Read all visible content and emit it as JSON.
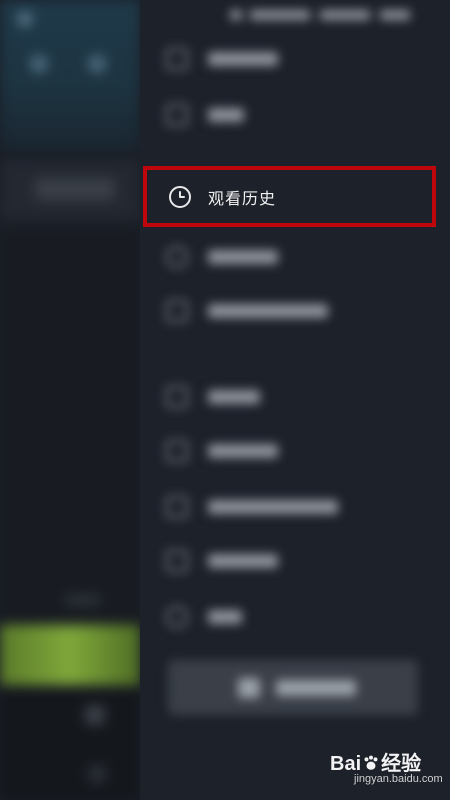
{
  "menu": {
    "highlighted_item": {
      "label": "观看历史",
      "icon": "clock-icon"
    }
  },
  "colors": {
    "highlight_border": "#c0060d",
    "drawer_background": "#1d212a"
  },
  "watermark": {
    "logo_text_left": "Bai",
    "logo_text_right": "经验",
    "sub_text": "jingyan.baidu.com"
  }
}
